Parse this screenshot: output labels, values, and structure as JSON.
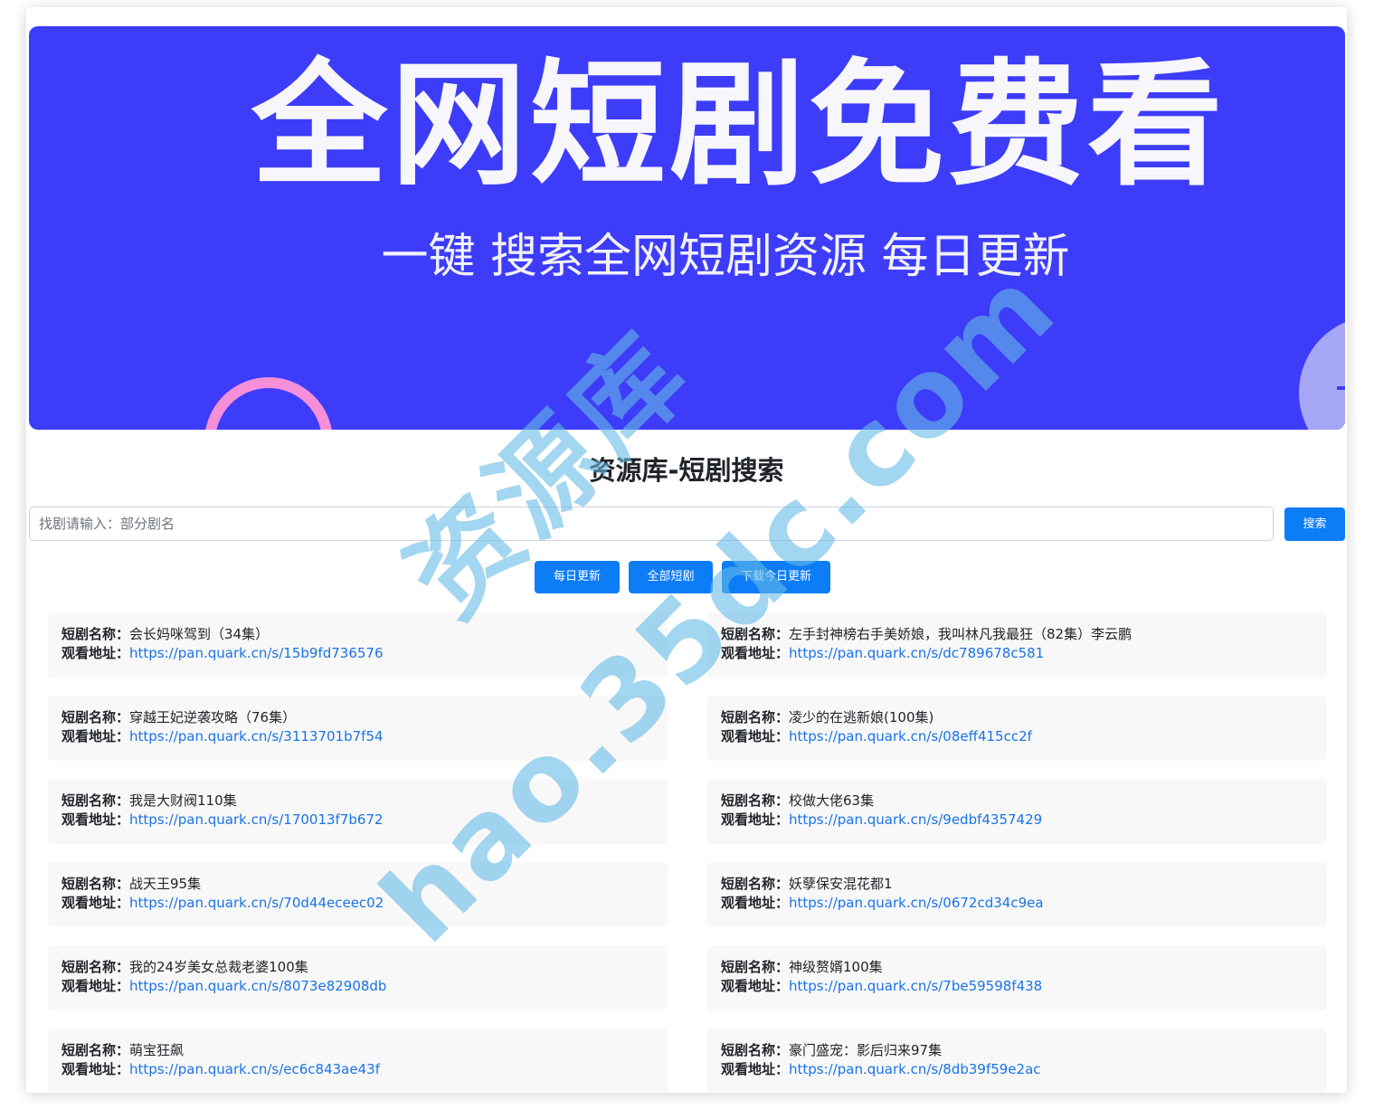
{
  "banner": {
    "title": "全网短剧免费看",
    "subtitle": "一键 搜索全网短剧资源 每日更新"
  },
  "page": {
    "title": "资源库-短剧搜索"
  },
  "search": {
    "placeholder": "找剧请输入：部分剧名",
    "value": "",
    "button_label": "搜索"
  },
  "actions": {
    "daily_label": "每日更新",
    "all_label": "全部短剧",
    "download_label": "下载今日更新"
  },
  "labels": {
    "name": "短剧名称：",
    "url": "观看地址："
  },
  "results": [
    {
      "name": "会长妈咪驾到（34集）",
      "url": "https://pan.quark.cn/s/15b9fd736576"
    },
    {
      "name": "左手封神榜右手美娇娘，我叫林凡我最狂（82集）李云鹏",
      "url": "https://pan.quark.cn/s/dc789678c581"
    },
    {
      "name": "穿越王妃逆袭攻略（76集）",
      "url": "https://pan.quark.cn/s/3113701b7f54"
    },
    {
      "name": "凌少的在逃新娘(100集)",
      "url": "https://pan.quark.cn/s/08eff415cc2f"
    },
    {
      "name": "我是大财阀110集",
      "url": "https://pan.quark.cn/s/170013f7b672"
    },
    {
      "name": "校做大佬63集",
      "url": "https://pan.quark.cn/s/9edbf4357429"
    },
    {
      "name": "战天王95集",
      "url": "https://pan.quark.cn/s/70d44eceec02"
    },
    {
      "name": "妖孽保安混花都1",
      "url": "https://pan.quark.cn/s/0672cd34c9ea"
    },
    {
      "name": "我的24岁美女总裁老婆100集",
      "url": "https://pan.quark.cn/s/8073e82908db"
    },
    {
      "name": "神级赘婿100集",
      "url": "https://pan.quark.cn/s/7be59598f438"
    },
    {
      "name": "萌宝狂飙",
      "url": "https://pan.quark.cn/s/ec6c843ae43f"
    },
    {
      "name": "豪门盛宠：影后归来97集",
      "url": "https://pan.quark.cn/s/8db39f59e2ac"
    }
  ],
  "watermark": {
    "line1": "资源库",
    "line2": "hao.35dc.com"
  },
  "colors": {
    "banner_bg": "#3d3cf8",
    "button": "#0d7cf7",
    "link": "#1a73e8",
    "card_bg": "#f8f8f8"
  }
}
